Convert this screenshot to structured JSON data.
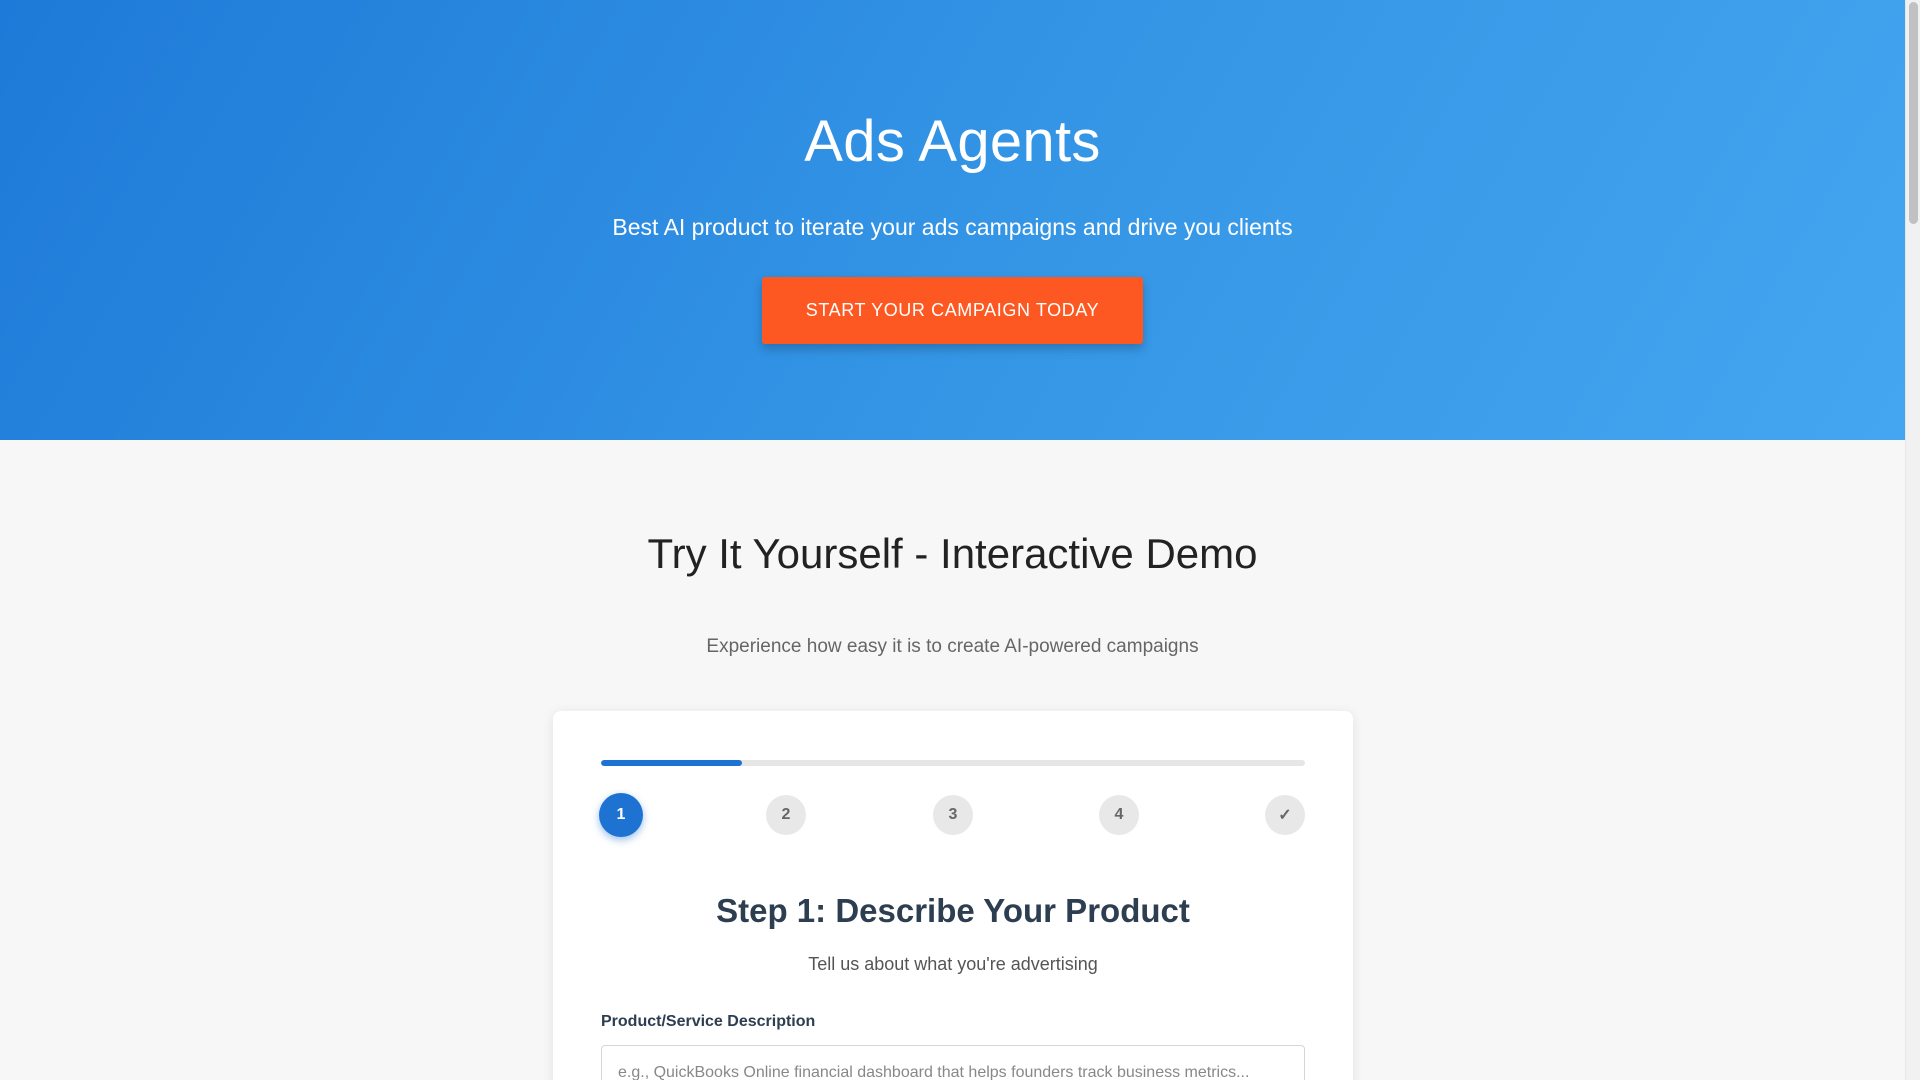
{
  "hero": {
    "title": "Ads Agents",
    "subtitle": "Best AI product to iterate your ads campaigns and drive you clients",
    "cta_label": "START YOUR CAMPAIGN TODAY",
    "gradient_start": "#1e7ad8",
    "gradient_end": "#44a6f0",
    "cta_color": "#fd5722"
  },
  "demo": {
    "title": "Try It Yourself - Interactive Demo",
    "subtitle": "Experience how easy it is to create AI-powered campaigns",
    "progress_fraction": 0.2,
    "steps": [
      {
        "label": "1",
        "state": "active"
      },
      {
        "label": "2",
        "state": "pending"
      },
      {
        "label": "3",
        "state": "pending"
      },
      {
        "label": "4",
        "state": "pending"
      },
      {
        "label": "✓",
        "state": "pending"
      }
    ],
    "step_title": "Step 1: Describe Your Product",
    "step_subtitle": "Tell us about what you're advertising",
    "field_label": "Product/Service Description",
    "field_placeholder": "e.g., QuickBooks Online financial dashboard that helps founders track business metrics...",
    "field_value": "",
    "accent_color": "#1e73d2"
  }
}
